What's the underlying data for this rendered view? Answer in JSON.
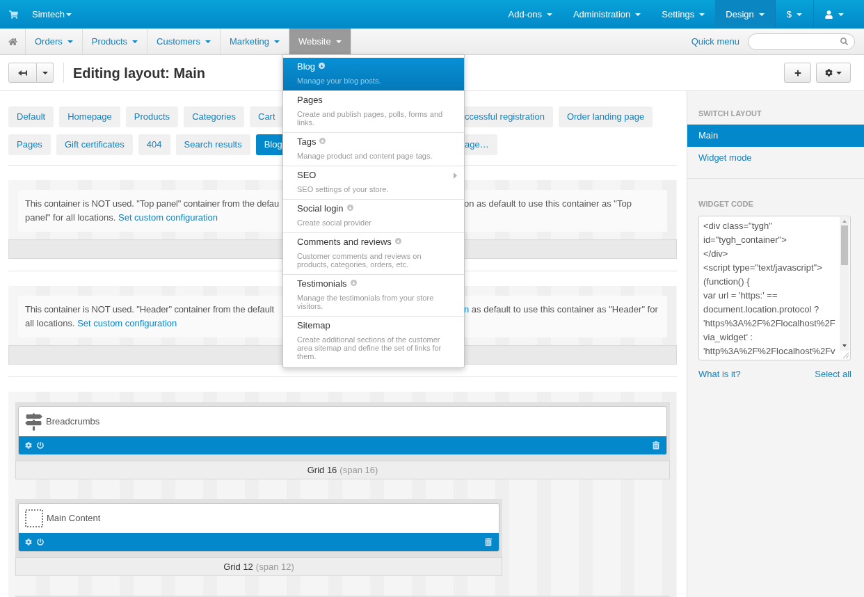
{
  "top_bar": {
    "store": "Simtech",
    "menu": [
      {
        "label": "Add-ons",
        "kind": "section",
        "selected": false
      },
      {
        "label": "Administration",
        "kind": "section",
        "selected": false
      },
      {
        "label": "Settings",
        "kind": "section",
        "selected": false
      },
      {
        "label": "Design",
        "kind": "section",
        "selected": true
      },
      {
        "label": "$",
        "kind": "currency",
        "selected": false
      }
    ]
  },
  "nav": {
    "items": [
      {
        "label": "Orders",
        "selected": false
      },
      {
        "label": "Products",
        "selected": false
      },
      {
        "label": "Customers",
        "selected": false
      },
      {
        "label": "Marketing",
        "selected": false
      },
      {
        "label": "Website",
        "selected": true
      }
    ],
    "quick_menu": "Quick menu"
  },
  "toolbar": {
    "title": "Editing layout: Main"
  },
  "layout_tabs": [
    {
      "before_menu": [
        {
          "label": "Default",
          "selected": false
        },
        {
          "label": "Homepage",
          "selected": false
        },
        {
          "label": "Products",
          "selected": false
        },
        {
          "label": "Categories",
          "selected": false
        },
        {
          "label": "Cart",
          "selected": false
        }
      ],
      "after_menu": [
        {
          "label": "ccessful registration",
          "selected": false
        },
        {
          "label": "Order landing page",
          "selected": false
        }
      ]
    },
    {
      "before_menu": [
        {
          "label": "Pages",
          "selected": false
        },
        {
          "label": "Gift certificates",
          "selected": false
        },
        {
          "label": "404",
          "selected": false
        },
        {
          "label": "Search results",
          "selected": false
        },
        {
          "label": "Blog",
          "selected": true
        }
      ],
      "after_menu": [
        {
          "label": "age…",
          "selected": false
        }
      ]
    }
  ],
  "containers": [
    {
      "line_1_left": "This container is NOT used. \"Top panel\" container from the defau",
      "line_1_right": "on as default to use this container as \"Top",
      "line_2": "panel\" for all locations.",
      "link": "Set custom configuration"
    },
    {
      "line_1_left": "This container is NOT used. \"Header\" container from the default",
      "line_1_right_link": "n",
      "line_1_right": "as default to use this container as \"Header\" for",
      "line_2": "all locations.",
      "link": "Set custom configuration"
    }
  ],
  "grids": [
    {
      "kind": "signpost",
      "title": "Breadcrumbs",
      "grid": "Grid 16",
      "span": "(span 16)",
      "full_width": true
    },
    {
      "kind": "dotted",
      "title": "Main Content",
      "grid": "Grid 12",
      "span": "(span 12)",
      "full_width": false
    }
  ],
  "sidebar": {
    "switch_layout": {
      "heading": "SWITCH LAYOUT",
      "items": [
        {
          "label": "Main",
          "selected": true
        },
        {
          "label": "Widget mode",
          "selected": false
        }
      ]
    },
    "widget_code": {
      "heading": "WIDGET CODE",
      "code_lines": [
        "<div class=\"tygh\"",
        "id=\"tygh_container\">",
        "</div>",
        "<script type=\"text/javascript\">",
        "(function() {",
        "var url = 'https:' ==",
        "document.location.protocol ?",
        "'https%3A%2F%2Flocalhost%2F",
        "via_widget' :",
        "'http%3A%2F%2Flocalhost%2Fv"
      ],
      "help_link": "What is it?",
      "select_link": "Select all"
    }
  },
  "website_menu": {
    "items": [
      {
        "title": "Blog",
        "description": "Manage your blog posts.",
        "selected": true,
        "addon": true,
        "submenu": false
      },
      {
        "title": "Pages",
        "description": "Create and publish pages, polls, forms and links.",
        "selected": false,
        "addon": false,
        "submenu": false
      },
      {
        "title": "Tags",
        "description": "Manage product and content page tags.",
        "selected": false,
        "addon": true,
        "submenu": false
      },
      {
        "title": "SEO",
        "description": "SEO settings of your store.",
        "selected": false,
        "addon": false,
        "submenu": true
      },
      {
        "title": "Social login",
        "description": "Create social provider",
        "selected": false,
        "addon": true,
        "submenu": false
      },
      {
        "title": "Comments and reviews",
        "description": "Customer comments and reviews on products, categories, orders, etc.",
        "selected": false,
        "addon": true,
        "submenu": false
      },
      {
        "title": "Testimonials",
        "description": "Manage the testimonials from your store visitors.",
        "selected": false,
        "addon": true,
        "submenu": false
      },
      {
        "title": "Sitemap",
        "description": "Create additional sections of the customer area sitemap and define the set of links for them.",
        "selected": false,
        "addon": false,
        "submenu": false
      }
    ]
  }
}
